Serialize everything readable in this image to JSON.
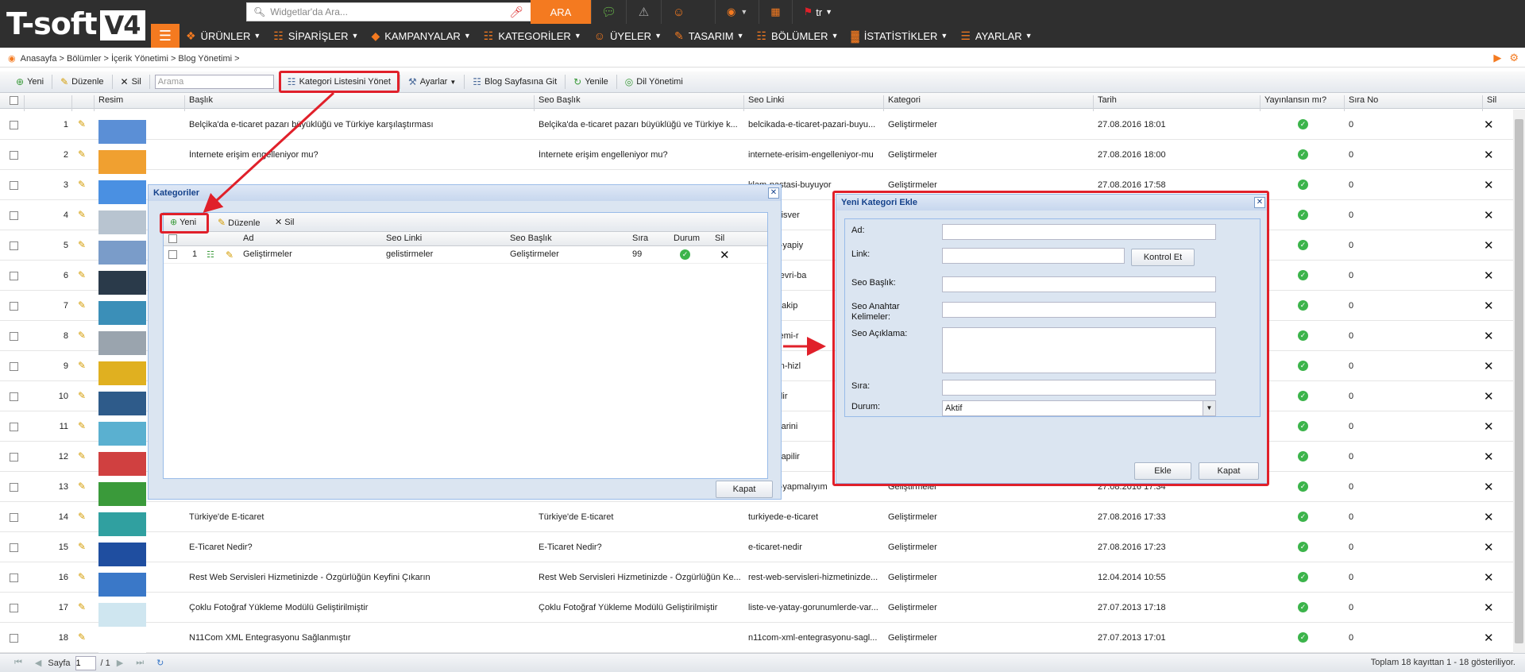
{
  "brand": {
    "logo_text": "T-soft",
    "logo_version": "V4",
    "accent": "#f47a20",
    "highlight": "#e0202a"
  },
  "topbar": {
    "search_placeholder": "Widgetlar'da Ara...",
    "search_button": "ARA",
    "language": "tr"
  },
  "nav": {
    "items": [
      {
        "label": "ÜRÜNLER",
        "icon": "box-icon"
      },
      {
        "label": "SİPARİŞLER",
        "icon": "cart-icon"
      },
      {
        "label": "KAMPANYALAR",
        "icon": "tag-icon"
      },
      {
        "label": "KATEGORİLER",
        "icon": "sitemap-icon"
      },
      {
        "label": "ÜYELER",
        "icon": "users-icon"
      },
      {
        "label": "TASARIM",
        "icon": "brush-icon"
      },
      {
        "label": "BÖLÜMLER",
        "icon": "modules-icon"
      },
      {
        "label": "İSTATİSTİKLER",
        "icon": "stats-icon"
      },
      {
        "label": "AYARLAR",
        "icon": "settings-icon"
      }
    ]
  },
  "breadcrumb": "Anasayfa > Bölümler > İçerik Yönetimi > Blog Yönetimi >",
  "toolbar": {
    "new": "Yeni",
    "edit": "Düzenle",
    "delete": "Sil",
    "search_placeholder": "Arama",
    "manage_categories": "Kategori Listesini Yönet",
    "settings": "Ayarlar",
    "goto_blog": "Blog Sayfasına Git",
    "refresh": "Yenile",
    "languages": "Dil Yönetimi"
  },
  "grid": {
    "columns": [
      "Resim",
      "Başlık",
      "Seo Başlık",
      "Seo Linki",
      "Kategori",
      "Tarih",
      "Yayınlansın mı?",
      "Sıra No",
      "Sil"
    ],
    "rows": [
      {
        "no": "1",
        "title": "Belçika'da e-ticaret pazarı büyüklüğü ve Türkiye karşılaştırması",
        "seo_title": "Belçika'da e-ticaret pazarı büyüklüğü ve Türkiye k...",
        "seo_link": "belcikada-e-ticaret-pazari-buyu...",
        "category": "Geliştirmeler",
        "date": "27.08.2016 18:01",
        "order": "0",
        "thumb": "#5b8fd6"
      },
      {
        "no": "2",
        "title": "İnternete erişim engelleniyor mu?",
        "seo_title": "İnternete erişim engelleniyor mu?",
        "seo_link": "internete-erisim-engelleniyor-mu",
        "category": "Geliştirmeler",
        "date": "27.08.2016 18:00",
        "order": "0",
        "thumb": "#f0a030"
      },
      {
        "no": "3",
        "title": "",
        "seo_title": "",
        "seo_link": "klam-pastasi-buyuyor",
        "category": "Geliştirmeler",
        "date": "27.08.2016 17:58",
        "order": "0",
        "thumb": "#4a90e2"
      },
      {
        "no": "4",
        "title": "",
        "seo_title": "",
        "seo_link": "online-alisver",
        "category": "",
        "date": "",
        "order": "0",
        "thumb": "#b8c4d0"
      },
      {
        "no": "5",
        "title": "",
        "seo_title": "",
        "seo_link": "e-ticaret-yapiy",
        "category": "",
        "date": "",
        "order": "0",
        "thumb": "#7a9cc9"
      },
      {
        "no": "6",
        "title": "",
        "seo_title": "",
        "seo_link": "eleme-devri-ba",
        "category": "",
        "date": "",
        "order": "0",
        "thumb": "#2a3a4a"
      },
      {
        "no": "7",
        "title": "",
        "seo_title": "",
        "seo_link": "e-yakin-takip",
        "category": "",
        "date": "",
        "order": "0",
        "thumb": "#3b8fb8"
      },
      {
        "no": "8",
        "title": "",
        "seo_title": "",
        "seo_link": "nlik-donemi-r",
        "category": "",
        "date": "",
        "order": "0",
        "thumb": "#9aa4ae"
      },
      {
        "no": "9",
        "title": "",
        "seo_title": "",
        "seo_link": "zikisin-en-hizl",
        "category": "",
        "date": "",
        "order": "0",
        "thumb": "#e0b020"
      },
      {
        "no": "10",
        "title": "",
        "seo_title": "",
        "seo_link": "ama-nedir",
        "category": "",
        "date": "",
        "order": "0",
        "thumb": "#2e5b8a"
      },
      {
        "no": "11",
        "title": "",
        "seo_title": "",
        "seo_link": "kullanicilarini",
        "category": "",
        "date": "",
        "order": "0",
        "thumb": "#5ab0d0"
      },
      {
        "no": "12",
        "title": "",
        "seo_title": "",
        "seo_link": "e-nasil-yapilir",
        "category": "",
        "date": "",
        "order": "0",
        "thumb": "#d04040"
      },
      {
        "no": "13",
        "title": "",
        "seo_title": "",
        "seo_link": "e-ticaret-yapmalıyım",
        "category": "Geliştirmeler",
        "date": "27.08.2016 17:34",
        "order": "0",
        "thumb": "#3a9a3a"
      },
      {
        "no": "14",
        "title": "Türkiye'de E-ticaret",
        "seo_title": "Türkiye'de E-ticaret",
        "seo_link": "turkiyede-e-ticaret",
        "category": "Geliştirmeler",
        "date": "27.08.2016 17:33",
        "order": "0",
        "thumb": "#30a0a0"
      },
      {
        "no": "15",
        "title": "E-Ticaret Nedir?",
        "seo_title": "E-Ticaret Nedir?",
        "seo_link": "e-ticaret-nedir",
        "category": "Geliştirmeler",
        "date": "27.08.2016 17:23",
        "order": "0",
        "thumb": "#1f4ea0"
      },
      {
        "no": "16",
        "title": "Rest Web Servisleri Hizmetinizde - Özgürlüğün Keyfini Çıkarın",
        "seo_title": "Rest Web Servisleri Hizmetinizde - Özgürlüğün Ke...",
        "seo_link": "rest-web-servisleri-hizmetinizde...",
        "category": "Geliştirmeler",
        "date": "12.04.2014 10:55",
        "order": "0",
        "thumb": "#3a78c8"
      },
      {
        "no": "17",
        "title": "Çoklu Fotoğraf Yükleme Modülü Geliştirilmiştir",
        "seo_title": "Çoklu Fotoğraf Yükleme Modülü Geliştirilmiştir",
        "seo_link": "liste-ve-yatay-gorunumlerde-var...",
        "category": "Geliştirmeler",
        "date": "27.07.2013 17:18",
        "order": "0",
        "thumb": "#cfe6f0"
      },
      {
        "no": "18",
        "title": "N11Com XML Entegrasyonu Sağlanmıştır",
        "seo_title": "",
        "seo_link": "n11com-xml-entegrasyonu-sagl...",
        "category": "Geliştirmeler",
        "date": "27.07.2013 17:01",
        "order": "0",
        "thumb": "#ffffff"
      }
    ]
  },
  "footer": {
    "page_label": "Sayfa",
    "page_value": "1",
    "page_total": "/ 1",
    "summary": "Toplam 18 kayıttan 1 - 18 gösteriliyor."
  },
  "kategoriler": {
    "title": "Kategoriler",
    "new": "Yeni",
    "edit": "Düzenle",
    "delete": "Sil",
    "columns": [
      "Ad",
      "Seo Linki",
      "Seo Başlık",
      "Sıra",
      "Durum",
      "Sil"
    ],
    "row": {
      "no": "1",
      "name": "Geliştirmeler",
      "seo_link": "gelistirmeler",
      "seo_title": "Geliştirmeler",
      "order": "99"
    },
    "close": "Kapat"
  },
  "yeni_kategori": {
    "title": "Yeni Kategori Ekle",
    "labels": {
      "ad": "Ad:",
      "link": "Link:",
      "seo_baslik": "Seo Başlık:",
      "seo_anahtar": "Seo Anahtar Kelimeler:",
      "seo_aciklama": "Seo Açıklama:",
      "sira": "Sıra:",
      "durum": "Durum:"
    },
    "check_button": "Kontrol Et",
    "durum_value": "Aktif",
    "add": "Ekle",
    "close": "Kapat"
  }
}
